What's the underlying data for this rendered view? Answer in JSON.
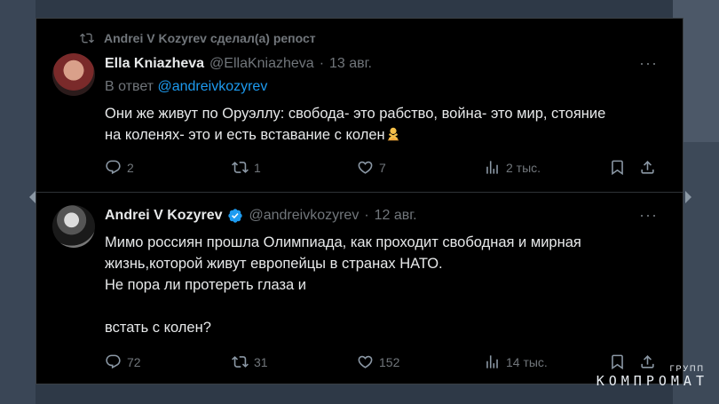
{
  "repost_banner": "Andrei V Kozyrev сделал(а) репост",
  "tweet1": {
    "name": "Ella Kniazheva",
    "handle": "@EllaKniazheva",
    "dot": "·",
    "date": "13 авг.",
    "reply_prefix": "В ответ",
    "reply_mention": "@andreivkozyrev",
    "text_lines": [
      "Они же живут по Оруэллу: свобода- это рабство, война- это мир, стояние",
      "на коленях- это и есть вставание с колен"
    ],
    "emoji": "person-gesturing-no",
    "counts": {
      "replies": "2",
      "reposts": "1",
      "likes": "7",
      "views": "2 тыс."
    }
  },
  "tweet2": {
    "name": "Andrei V Kozyrev",
    "handle": "@andreivkozyrev",
    "dot": "·",
    "date": "12 авг.",
    "text_lines": [
      "Мимо россиян прошла Олимпиада, как проходит свободная и мирная",
      "жизнь,которой живут европейцы в странах НАТО.",
      "Не пора ли протереть глаза и",
      "",
      "встать с колен?"
    ],
    "counts": {
      "replies": "72",
      "reposts": "31",
      "likes": "152",
      "views": "14 тыс."
    }
  },
  "more_label": "···",
  "watermark": {
    "top": "ГРУПП",
    "main": "КОМПРОМАТ"
  },
  "colors": {
    "background": "#000000",
    "text": "#e7e9ea",
    "muted": "#71767b",
    "link": "#1d9bf0",
    "verified": "#1d9bf0"
  }
}
